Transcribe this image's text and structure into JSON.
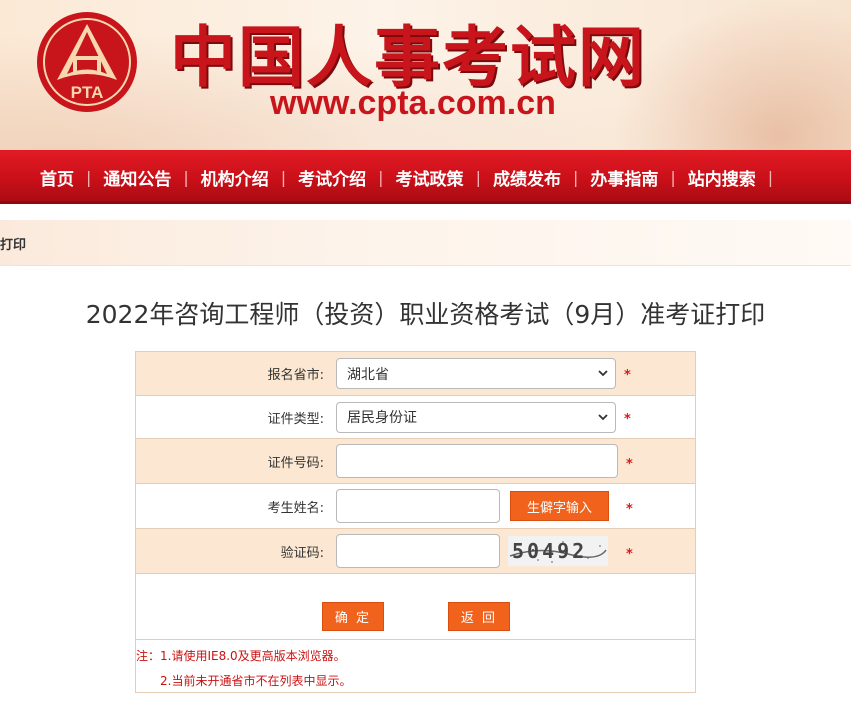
{
  "header": {
    "logo_text": "PTA",
    "site_title": "中国人事考试网",
    "site_url": "www.cpta.com.cn"
  },
  "nav": {
    "items": [
      "首页",
      "通知公告",
      "机构介绍",
      "考试介绍",
      "考试政策",
      "成绩发布",
      "办事指南",
      "站内搜索"
    ]
  },
  "breadcrumb": "打印",
  "page_title": "2022年咨询工程师（投资）职业资格考试（9月）准考证打印",
  "form": {
    "province": {
      "label": "报名省市:",
      "value": "湖北省"
    },
    "id_type": {
      "label": "证件类型:",
      "value": "居民身份证"
    },
    "id_number": {
      "label": "证件号码:",
      "value": ""
    },
    "name": {
      "label": "考生姓名:",
      "value": "",
      "rare_char_button": "生僻字输入"
    },
    "captcha": {
      "label": "验证码:",
      "value": "",
      "image_text": "50492"
    },
    "required_mark": "*",
    "confirm_label": "确 定",
    "back_label": "返 回"
  },
  "notes": {
    "line1": "注：1.请使用IE8.0及更高版本浏览器。",
    "line2": "2.当前未开通省市不在列表中显示。"
  },
  "colors": {
    "brand_red": "#c8141b",
    "button_orange": "#f1621c",
    "row_beige": "#fce8d2"
  }
}
